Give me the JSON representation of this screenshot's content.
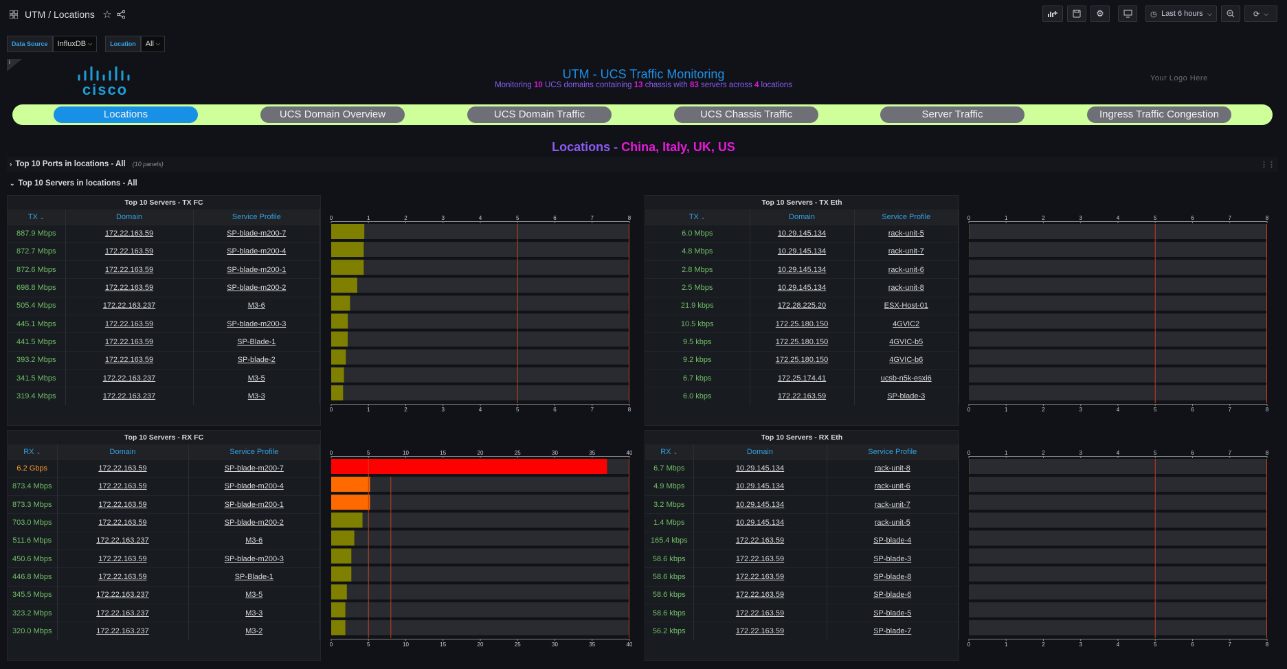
{
  "header": {
    "title": "UTM / Locations",
    "time_range": "Last 6 hours"
  },
  "vars": {
    "ds_label": "Data Source",
    "ds_value": "InfluxDB",
    "loc_label": "Location",
    "loc_value": "All"
  },
  "info": "i",
  "logo": {
    "text": "cisco",
    "right": "Your Logo Here"
  },
  "banner": {
    "title": "UTM - UCS Traffic Monitoring",
    "sub_1": "Monitoring",
    "domains": "10",
    "sub_2": "UCS domains containing",
    "chassis": "13",
    "sub_3": "chassis with",
    "servers": "83",
    "sub_4": "servers across",
    "locations": "4",
    "sub_5": "locations"
  },
  "nav": [
    "Locations",
    "UCS Domain Overview",
    "UCS Domain Traffic",
    "UCS Chassis Traffic",
    "Server Traffic",
    "Ingress Traffic Congestion"
  ],
  "loc_title": {
    "prefix": "Locations -",
    "list": "China, Italy, UK, US"
  },
  "rows": {
    "ports": "Top 10 Ports in locations - All",
    "ports_count": "(10 panels)",
    "servers": "Top 10 Servers in locations - All"
  },
  "panels": {
    "tx_fc": {
      "title": "Top 10 Servers - TX FC",
      "cols": [
        "TX",
        "Domain",
        "Service Profile"
      ],
      "rows": [
        [
          "887.9 Mbps",
          "172.22.163.59",
          "SP-blade-m200-7"
        ],
        [
          "872.7 Mbps",
          "172.22.163.59",
          "SP-blade-m200-4"
        ],
        [
          "872.6 Mbps",
          "172.22.163.59",
          "SP-blade-m200-1"
        ],
        [
          "698.8 Mbps",
          "172.22.163.59",
          "SP-blade-m200-2"
        ],
        [
          "505.4 Mbps",
          "172.22.163.237",
          "M3-6"
        ],
        [
          "445.1 Mbps",
          "172.22.163.59",
          "SP-blade-m200-3"
        ],
        [
          "441.5 Mbps",
          "172.22.163.59",
          "SP-Blade-1"
        ],
        [
          "393.2 Mbps",
          "172.22.163.59",
          "SP-blade-2"
        ],
        [
          "341.5 Mbps",
          "172.22.163.237",
          "M3-5"
        ],
        [
          "319.4 Mbps",
          "172.22.163.237",
          "M3-3"
        ]
      ]
    },
    "tx_eth": {
      "title": "Top 10 Servers - TX Eth",
      "cols": [
        "TX",
        "Domain",
        "Service Profile"
      ],
      "rows": [
        [
          "6.0 Mbps",
          "10.29.145.134",
          "rack-unit-5"
        ],
        [
          "4.8 Mbps",
          "10.29.145.134",
          "rack-unit-7"
        ],
        [
          "2.8 Mbps",
          "10.29.145.134",
          "rack-unit-6"
        ],
        [
          "2.5 Mbps",
          "10.29.145.134",
          "rack-unit-8"
        ],
        [
          "21.9 kbps",
          "172.28.225.20",
          "ESX-Host-01"
        ],
        [
          "10.5 kbps",
          "172.25.180.150",
          "4GVIC2"
        ],
        [
          "9.5 kbps",
          "172.25.180.150",
          "4GVIC-b5"
        ],
        [
          "9.2 kbps",
          "172.25.180.150",
          "4GVIC-b6"
        ],
        [
          "6.7 kbps",
          "172.25.174.41",
          "ucsb-n5k-esxi6"
        ],
        [
          "6.0 kbps",
          "172.22.163.59",
          "SP-blade-3"
        ]
      ]
    },
    "rx_fc": {
      "title": "Top 10 Servers - RX FC",
      "cols": [
        "RX",
        "Domain",
        "Service Profile"
      ],
      "rows": [
        [
          "6.2 Gbps",
          "172.22.163.59",
          "SP-blade-m200-7"
        ],
        [
          "873.4 Mbps",
          "172.22.163.59",
          "SP-blade-m200-4"
        ],
        [
          "873.3 Mbps",
          "172.22.163.59",
          "SP-blade-m200-1"
        ],
        [
          "703.0 Mbps",
          "172.22.163.59",
          "SP-blade-m200-2"
        ],
        [
          "511.6 Mbps",
          "172.22.163.237",
          "M3-6"
        ],
        [
          "450.6 Mbps",
          "172.22.163.59",
          "SP-blade-m200-3"
        ],
        [
          "446.8 Mbps",
          "172.22.163.59",
          "SP-Blade-1"
        ],
        [
          "345.5 Mbps",
          "172.22.163.237",
          "M3-5"
        ],
        [
          "323.2 Mbps",
          "172.22.163.237",
          "M3-3"
        ],
        [
          "320.0 Mbps",
          "172.22.163.237",
          "M3-2"
        ]
      ]
    },
    "rx_eth": {
      "title": "Top 10 Servers - RX Eth",
      "cols": [
        "RX",
        "Domain",
        "Service Profile"
      ],
      "rows": [
        [
          "6.7 Mbps",
          "10.29.145.134",
          "rack-unit-8"
        ],
        [
          "4.9 Mbps",
          "10.29.145.134",
          "rack-unit-6"
        ],
        [
          "3.2 Mbps",
          "10.29.145.134",
          "rack-unit-7"
        ],
        [
          "1.4 Mbps",
          "10.29.145.134",
          "rack-unit-5"
        ],
        [
          "165.4 kbps",
          "172.22.163.59",
          "SP-blade-4"
        ],
        [
          "58.6 kbps",
          "172.22.163.59",
          "SP-blade-3"
        ],
        [
          "58.6 kbps",
          "172.22.163.59",
          "SP-blade-8"
        ],
        [
          "58.6 kbps",
          "172.22.163.59",
          "SP-blade-6"
        ],
        [
          "58.6 kbps",
          "172.22.163.59",
          "SP-blade-5"
        ],
        [
          "56.2 kbps",
          "172.22.163.59",
          "SP-blade-7"
        ]
      ]
    }
  },
  "chart_data": [
    {
      "type": "bar",
      "name": "tx_fc",
      "ticks": [
        "0",
        "1",
        "2",
        "3",
        "4",
        "5",
        "6",
        "7",
        "8"
      ],
      "max": 8,
      "threshold": 5,
      "values": [
        0.888,
        0.873,
        0.873,
        0.699,
        0.505,
        0.445,
        0.442,
        0.393,
        0.342,
        0.319
      ]
    },
    {
      "type": "bar",
      "name": "tx_eth",
      "ticks": [
        "0",
        "1",
        "2",
        "3",
        "4",
        "5",
        "6",
        "7",
        "8"
      ],
      "max": 8,
      "threshold": 5,
      "values": [
        0.006,
        0.0048,
        0.0028,
        0.0025,
        2e-05,
        1e-05,
        1e-05,
        1e-05,
        1e-05,
        1e-05
      ]
    },
    {
      "type": "bar",
      "name": "rx_fc",
      "ticks": [
        "0",
        "5",
        "10",
        "15",
        "20",
        "25",
        "30",
        "35",
        "40"
      ],
      "max": 40,
      "threshold": 5,
      "values": [
        37,
        5.2,
        5.2,
        4.2,
        3.1,
        2.7,
        2.7,
        2.1,
        1.9,
        1.9
      ]
    },
    {
      "type": "bar",
      "name": "rx_eth",
      "ticks": [
        "0",
        "1",
        "2",
        "3",
        "4",
        "5",
        "6",
        "7",
        "8"
      ],
      "max": 8,
      "threshold": 5,
      "values": [
        0.0067,
        0.0049,
        0.0032,
        0.0014,
        0.00017,
        6e-05,
        6e-05,
        6e-05,
        6e-05,
        6e-05
      ]
    }
  ]
}
